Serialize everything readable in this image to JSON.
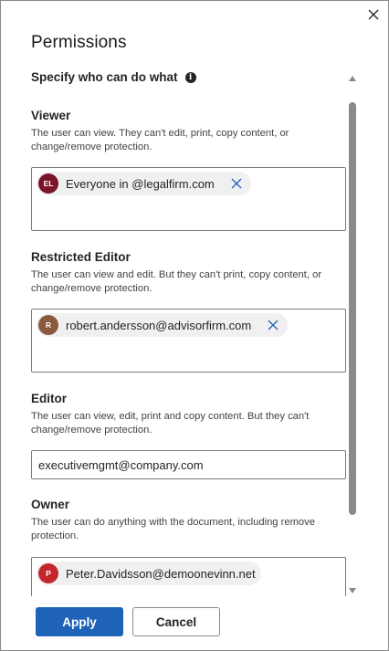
{
  "dialog": {
    "title": "Permissions",
    "subtitle": "Specify who can do what",
    "info_icon": "info-icon",
    "close_icon": "close-icon"
  },
  "sections": {
    "viewer": {
      "heading": "Viewer",
      "description": "The user can view. They can't edit, print, copy content, or change/remove protection.",
      "chip": {
        "initials": "EL",
        "label": "Everyone in @legalfirm.com",
        "avatar_color": "#7a1428",
        "remove_icon": "close-icon"
      }
    },
    "restricted_editor": {
      "heading": "Restricted Editor",
      "description": "The user can view and edit. But they can't print, copy content, or change/remove protection.",
      "chip": {
        "initials": "R",
        "label": "robert.andersson@advisorfirm.com",
        "avatar_color": "#8b5a3c",
        "remove_icon": "close-icon"
      }
    },
    "editor": {
      "heading": "Editor",
      "description": "The user can view, edit, print and copy content. But they can't change/remove protection.",
      "value": "executivemgmt@company.com"
    },
    "owner": {
      "heading": "Owner",
      "description": "The user can do anything with the document, including remove protection.",
      "chip": {
        "initials": "P",
        "label": "Peter.Davidsson@demoonevinn.net",
        "avatar_color": "#c4262e"
      }
    }
  },
  "footer": {
    "apply_label": "Apply",
    "cancel_label": "Cancel",
    "accent": "#1e63b8"
  }
}
